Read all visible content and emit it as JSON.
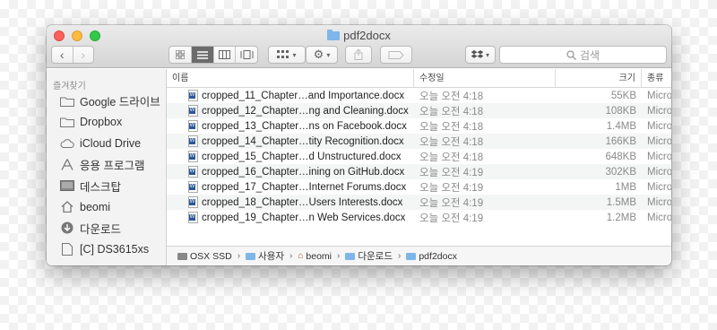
{
  "window": {
    "title": "pdf2docx"
  },
  "toolbar": {
    "back_glyph": "‹",
    "forward_glyph": "›",
    "search_placeholder": "검색",
    "icons": [
      "view-icons-icon",
      "view-list-icon",
      "view-columns-icon",
      "view-coverflow-icon",
      "arrange-icon",
      "gear-icon",
      "share-icon",
      "tag-icon",
      "dropbox-icon",
      "search-icon"
    ]
  },
  "sidebar": {
    "heading": "즐겨찾기",
    "items": [
      {
        "label": "Google 드라이브",
        "icon": "folder-icon"
      },
      {
        "label": "Dropbox",
        "icon": "folder-icon"
      },
      {
        "label": "iCloud Drive",
        "icon": "cloud-icon"
      },
      {
        "label": "응용 프로그램",
        "icon": "applications-icon"
      },
      {
        "label": "데스크탑",
        "icon": "desktop-icon"
      },
      {
        "label": "beomi",
        "icon": "home-icon"
      },
      {
        "label": "다운로드",
        "icon": "download-icon"
      },
      {
        "label": "[C] DS3615xs",
        "icon": "document-icon"
      }
    ]
  },
  "columns": {
    "name": "이름",
    "date": "수정일",
    "size": "크기",
    "kind": "종류"
  },
  "files": [
    {
      "name": "cropped_11_Chapter…and Importance.docx",
      "date": "오늘 오전 4:18",
      "size": "55KB",
      "kind": "Micro"
    },
    {
      "name": "cropped_12_Chapter…ng and Cleaning.docx",
      "date": "오늘 오전 4:18",
      "size": "108KB",
      "kind": "Micro"
    },
    {
      "name": "cropped_13_Chapter…ns on Facebook.docx",
      "date": "오늘 오전 4:18",
      "size": "1.4MB",
      "kind": "Micro"
    },
    {
      "name": "cropped_14_Chapter…tity Recognition.docx",
      "date": "오늘 오전 4:18",
      "size": "166KB",
      "kind": "Micro"
    },
    {
      "name": "cropped_15_Chapter…d Unstructured.docx",
      "date": "오늘 오전 4:18",
      "size": "648KB",
      "kind": "Micro"
    },
    {
      "name": "cropped_16_Chapter…ining on GitHub.docx",
      "date": "오늘 오전 4:19",
      "size": "302KB",
      "kind": "Micro"
    },
    {
      "name": "cropped_17_Chapter…Internet Forums.docx",
      "date": "오늘 오전 4:19",
      "size": "1MB",
      "kind": "Micro"
    },
    {
      "name": "cropped_18_Chapter…Users Interests.docx",
      "date": "오늘 오전 4:19",
      "size": "1.5MB",
      "kind": "Micro"
    },
    {
      "name": "cropped_19_Chapter…n Web Services.docx",
      "date": "오늘 오전 4:19",
      "size": "1.2MB",
      "kind": "Micro"
    }
  ],
  "pathbar": [
    {
      "label": "OSX SSD",
      "icon": "disk-icon"
    },
    {
      "label": "사용자",
      "icon": "folder-icon"
    },
    {
      "label": "beomi",
      "icon": "home-icon"
    },
    {
      "label": "다운로드",
      "icon": "download-folder-icon"
    },
    {
      "label": "pdf2docx",
      "icon": "folder-icon"
    }
  ],
  "colors": {
    "close": "#fc605c",
    "minimize": "#fdbc40",
    "maximize": "#34c84a",
    "folder": "#7eb6e9"
  }
}
